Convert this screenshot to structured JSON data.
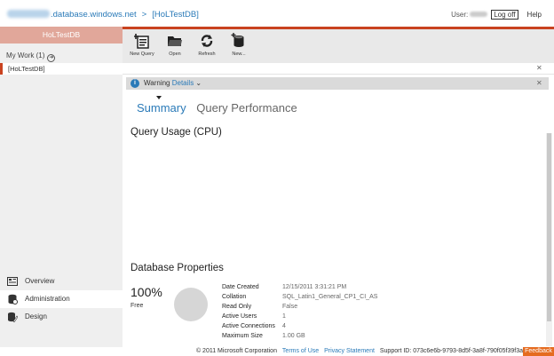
{
  "header": {
    "server_suffix": ".database.windows.net",
    "separator": ">",
    "database": "[HoLTestDB]",
    "user_label": "User:",
    "logoff_label": "Log off",
    "help_label": "Help"
  },
  "sidebar": {
    "db_title": "HoLTestDB",
    "mywork_label": "My Work (1)",
    "mywork_items": [
      "[HoLTestDB]"
    ],
    "nav": [
      {
        "label": "Overview",
        "icon": "overview-icon"
      },
      {
        "label": "Administration",
        "icon": "administration-icon"
      },
      {
        "label": "Design",
        "icon": "design-icon"
      }
    ]
  },
  "toolbar": {
    "new_query": "New Query",
    "open": "Open",
    "refresh": "Refresh",
    "new": "New..."
  },
  "warning": {
    "label": "Warning",
    "details": "Details",
    "chevron": "⌄"
  },
  "tabs": {
    "summary": "Summary",
    "query_performance": "Query Performance"
  },
  "sections": {
    "query_usage": "Query Usage (CPU)",
    "db_properties": "Database Properties"
  },
  "usage": {
    "percent": "100%",
    "free_label": "Free"
  },
  "properties": [
    {
      "key": "Date Created",
      "value": "12/15/2011 3:31:21 PM"
    },
    {
      "key": "Collation",
      "value": "SQL_Latin1_General_CP1_CI_AS"
    },
    {
      "key": "Read Only",
      "value": "False"
    },
    {
      "key": "Active Users",
      "value": "1"
    },
    {
      "key": "Active Connections",
      "value": "4"
    },
    {
      "key": "Maximum Size",
      "value": "1.00 GB"
    }
  ],
  "footer": {
    "copyright": "© 2011 Microsoft Corporation",
    "terms": "Terms of Use",
    "privacy": "Privacy Statement",
    "support": "Support ID: 073c6e6b-9793-8d5f-3a8f-790f05f39f3a",
    "feedback": "Feedback"
  },
  "colors": {
    "accent": "#c9421f",
    "link": "#2a7ab8",
    "db_title_bg": "#e1a79a",
    "feedback_bg": "#e56b1f"
  }
}
